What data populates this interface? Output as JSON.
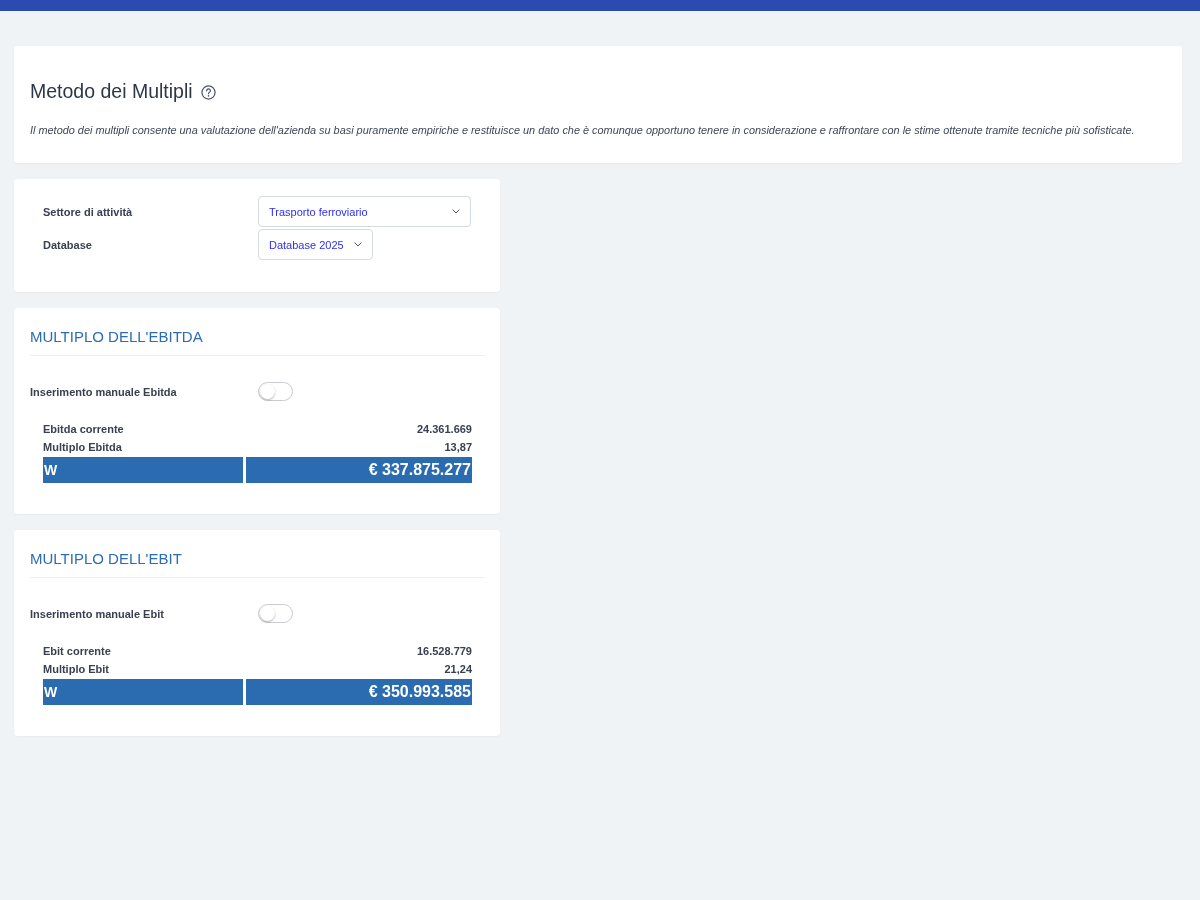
{
  "header": {
    "title": "Metodo dei Multipli",
    "description": "Il metodo dei multipli consente una valutazione dell'azienda su basi puramente empiriche e restituisce un dato che è comunque opportuno tenere in considerazione e raffrontare con le stime ottenute tramite tecniche più sofisticate."
  },
  "filters": [
    {
      "label": "Settore di attività",
      "value": "Trasporto ferroviario"
    },
    {
      "label": "Database",
      "value": "Database 2025"
    }
  ],
  "sections": [
    {
      "title": "MULTIPLO DELL'EBITDA",
      "toggle": {
        "label": "Inserimento manuale Ebitda",
        "on": false
      },
      "rows": [
        {
          "label": "Ebitda corrente",
          "value": "24.361.669"
        },
        {
          "label": "Multiplo Ebitda",
          "value": "13,87"
        }
      ],
      "result": {
        "label": "W",
        "value": "€ 337.875.277"
      }
    },
    {
      "title": "MULTIPLO DELL'EBIT",
      "toggle": {
        "label": "Inserimento manuale Ebit",
        "on": false
      },
      "rows": [
        {
          "label": "Ebit corrente",
          "value": "16.528.779"
        },
        {
          "label": "Multiplo Ebit",
          "value": "21,24"
        }
      ],
      "result": {
        "label": "W",
        "value": "€ 350.993.585"
      }
    }
  ]
}
